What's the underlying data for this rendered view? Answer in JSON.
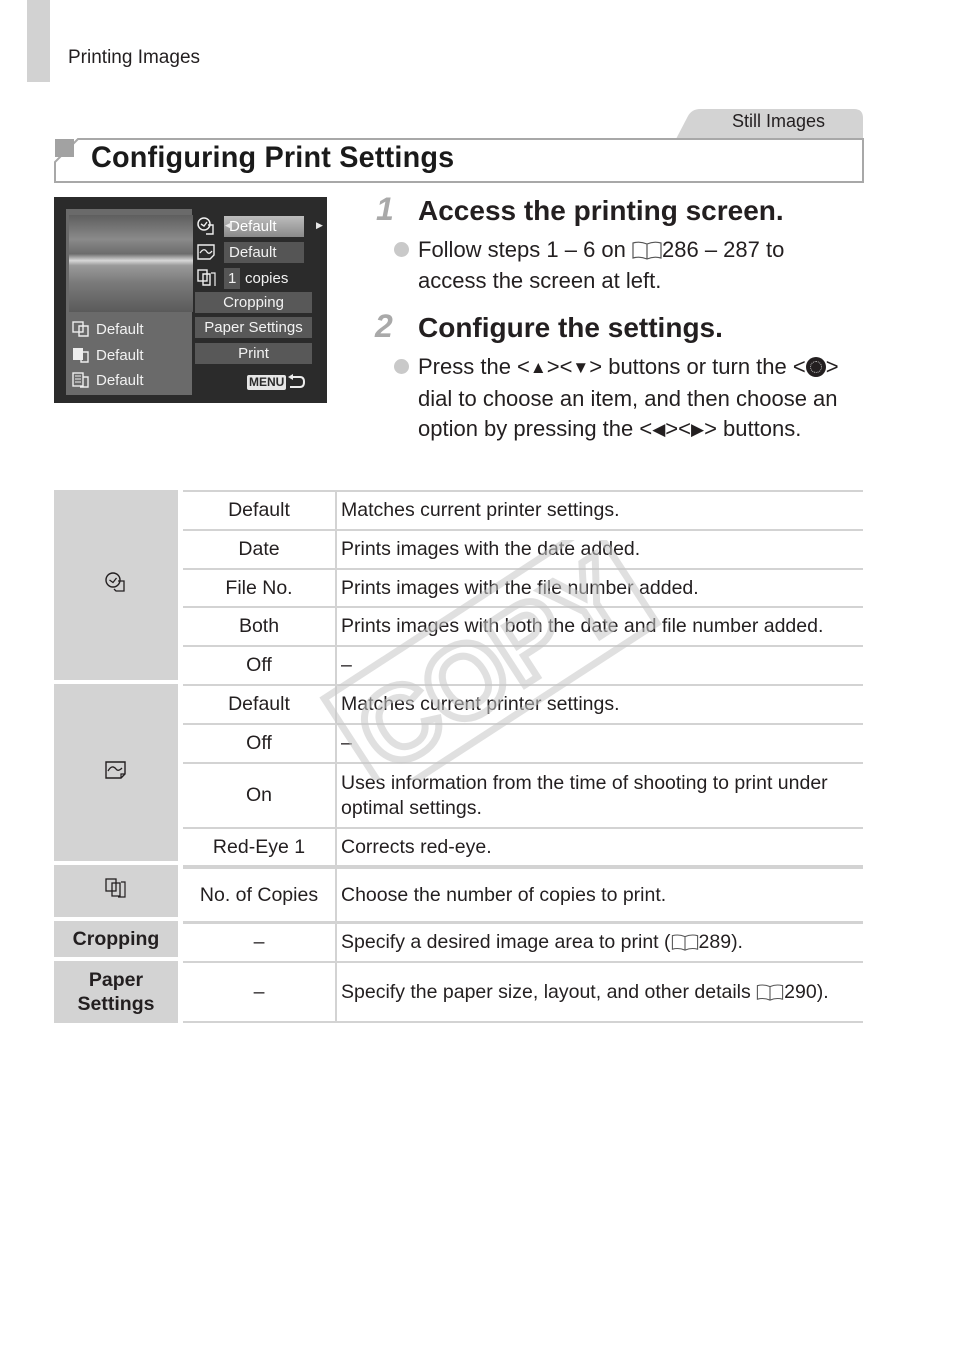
{
  "page": {
    "running_head": "Printing Images",
    "section_tag": "Still Images",
    "section_title": "Configuring Print Settings",
    "watermark": "COPY"
  },
  "camera_screen": {
    "left_items": [
      {
        "icon": "paper-type-icon",
        "value": "Default"
      },
      {
        "icon": "print-quality-icon",
        "value": "Default"
      },
      {
        "icon": "layout-icon",
        "value": "Default"
      }
    ],
    "right_items": [
      {
        "icon": "date-print-icon",
        "value": "Default",
        "selected": true
      },
      {
        "icon": "image-optimize-icon",
        "value": "Default",
        "selected": false
      },
      {
        "icon": "copies-icon",
        "count": "1",
        "unit": "copies",
        "selected": false
      }
    ],
    "buttons": [
      "Cropping",
      "Paper Settings",
      "Print"
    ],
    "menu_label": "MENU",
    "back_icon": "return-arrow-icon"
  },
  "steps": [
    {
      "number": "1",
      "title": "Access the printing screen.",
      "bullet": {
        "before": "Follow steps 1 – 6 on ",
        "ref": "286 – 287",
        "after": " to access the screen at left."
      }
    },
    {
      "number": "2",
      "title": "Configure the settings.",
      "bullet": {
        "p1": "Press the <",
        "up": "▲",
        "p2": "><",
        "down": "▼",
        "p3": "> buttons or turn the <",
        "p4": "> dial to choose an item, and then choose an option by pressing the <",
        "left": "◀",
        "p5": "><",
        "right": "▶",
        "p6": "> buttons."
      }
    }
  ],
  "table": {
    "groups": [
      {
        "header_icon": "date-print-icon",
        "rows": [
          {
            "option": "Default",
            "description": "Matches current printer settings."
          },
          {
            "option": "Date",
            "description": "Prints images with the date added."
          },
          {
            "option": "File No.",
            "description": "Prints images with the file number added."
          },
          {
            "option": "Both",
            "description": "Prints images with both the date and file number added."
          },
          {
            "option": "Off",
            "description": "–"
          }
        ]
      },
      {
        "header_icon": "image-optimize-icon",
        "rows": [
          {
            "option": "Default",
            "description": "Matches current printer settings."
          },
          {
            "option": "Off",
            "description": "–"
          },
          {
            "option": "On",
            "description": "Uses information from the time of shooting to print under optimal settings."
          },
          {
            "option": "Red-Eye 1",
            "description": "Corrects red-eye."
          }
        ]
      },
      {
        "header_icon": "copies-icon",
        "rows": [
          {
            "option": "No. of Copies",
            "description": "Choose the number of copies to print."
          }
        ]
      },
      {
        "header_label": "Cropping",
        "rows": [
          {
            "option": "–",
            "description_before": "Specify a desired image area to print (",
            "ref": "289",
            "description_after": ")."
          }
        ]
      },
      {
        "header_label": "Paper Settings",
        "rows": [
          {
            "option": "–",
            "description_before": "Specify the paper size, layout, and other details ",
            "ref": "290",
            "description_after": ")."
          }
        ]
      }
    ]
  }
}
